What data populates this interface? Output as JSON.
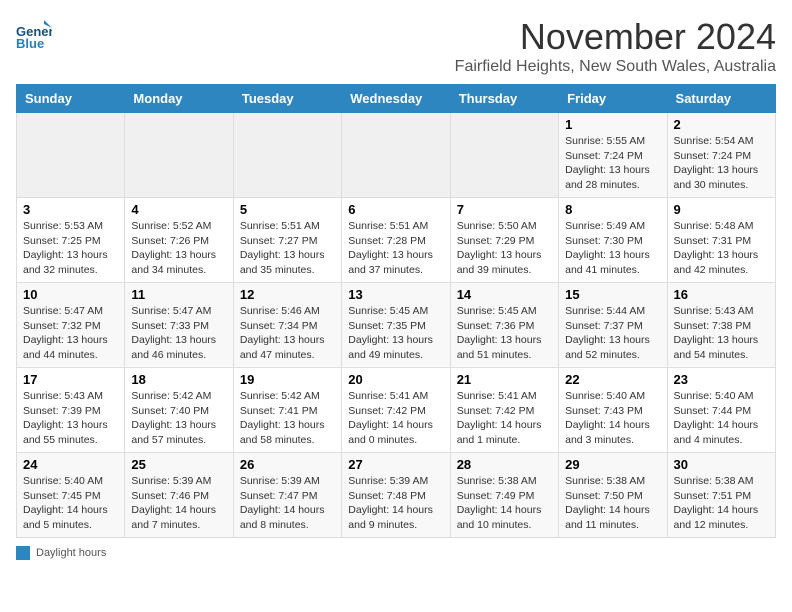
{
  "header": {
    "logo_general": "General",
    "logo_blue": "Blue",
    "month_title": "November 2024",
    "subtitle": "Fairfield Heights, New South Wales, Australia"
  },
  "days_of_week": [
    "Sunday",
    "Monday",
    "Tuesday",
    "Wednesday",
    "Thursday",
    "Friday",
    "Saturday"
  ],
  "weeks": [
    [
      {
        "day": "",
        "info": ""
      },
      {
        "day": "",
        "info": ""
      },
      {
        "day": "",
        "info": ""
      },
      {
        "day": "",
        "info": ""
      },
      {
        "day": "",
        "info": ""
      },
      {
        "day": "1",
        "info": "Sunrise: 5:55 AM\nSunset: 7:24 PM\nDaylight: 13 hours and 28 minutes."
      },
      {
        "day": "2",
        "info": "Sunrise: 5:54 AM\nSunset: 7:24 PM\nDaylight: 13 hours and 30 minutes."
      }
    ],
    [
      {
        "day": "3",
        "info": "Sunrise: 5:53 AM\nSunset: 7:25 PM\nDaylight: 13 hours and 32 minutes."
      },
      {
        "day": "4",
        "info": "Sunrise: 5:52 AM\nSunset: 7:26 PM\nDaylight: 13 hours and 34 minutes."
      },
      {
        "day": "5",
        "info": "Sunrise: 5:51 AM\nSunset: 7:27 PM\nDaylight: 13 hours and 35 minutes."
      },
      {
        "day": "6",
        "info": "Sunrise: 5:51 AM\nSunset: 7:28 PM\nDaylight: 13 hours and 37 minutes."
      },
      {
        "day": "7",
        "info": "Sunrise: 5:50 AM\nSunset: 7:29 PM\nDaylight: 13 hours and 39 minutes."
      },
      {
        "day": "8",
        "info": "Sunrise: 5:49 AM\nSunset: 7:30 PM\nDaylight: 13 hours and 41 minutes."
      },
      {
        "day": "9",
        "info": "Sunrise: 5:48 AM\nSunset: 7:31 PM\nDaylight: 13 hours and 42 minutes."
      }
    ],
    [
      {
        "day": "10",
        "info": "Sunrise: 5:47 AM\nSunset: 7:32 PM\nDaylight: 13 hours and 44 minutes."
      },
      {
        "day": "11",
        "info": "Sunrise: 5:47 AM\nSunset: 7:33 PM\nDaylight: 13 hours and 46 minutes."
      },
      {
        "day": "12",
        "info": "Sunrise: 5:46 AM\nSunset: 7:34 PM\nDaylight: 13 hours and 47 minutes."
      },
      {
        "day": "13",
        "info": "Sunrise: 5:45 AM\nSunset: 7:35 PM\nDaylight: 13 hours and 49 minutes."
      },
      {
        "day": "14",
        "info": "Sunrise: 5:45 AM\nSunset: 7:36 PM\nDaylight: 13 hours and 51 minutes."
      },
      {
        "day": "15",
        "info": "Sunrise: 5:44 AM\nSunset: 7:37 PM\nDaylight: 13 hours and 52 minutes."
      },
      {
        "day": "16",
        "info": "Sunrise: 5:43 AM\nSunset: 7:38 PM\nDaylight: 13 hours and 54 minutes."
      }
    ],
    [
      {
        "day": "17",
        "info": "Sunrise: 5:43 AM\nSunset: 7:39 PM\nDaylight: 13 hours and 55 minutes."
      },
      {
        "day": "18",
        "info": "Sunrise: 5:42 AM\nSunset: 7:40 PM\nDaylight: 13 hours and 57 minutes."
      },
      {
        "day": "19",
        "info": "Sunrise: 5:42 AM\nSunset: 7:41 PM\nDaylight: 13 hours and 58 minutes."
      },
      {
        "day": "20",
        "info": "Sunrise: 5:41 AM\nSunset: 7:42 PM\nDaylight: 14 hours and 0 minutes."
      },
      {
        "day": "21",
        "info": "Sunrise: 5:41 AM\nSunset: 7:42 PM\nDaylight: 14 hours and 1 minute."
      },
      {
        "day": "22",
        "info": "Sunrise: 5:40 AM\nSunset: 7:43 PM\nDaylight: 14 hours and 3 minutes."
      },
      {
        "day": "23",
        "info": "Sunrise: 5:40 AM\nSunset: 7:44 PM\nDaylight: 14 hours and 4 minutes."
      }
    ],
    [
      {
        "day": "24",
        "info": "Sunrise: 5:40 AM\nSunset: 7:45 PM\nDaylight: 14 hours and 5 minutes."
      },
      {
        "day": "25",
        "info": "Sunrise: 5:39 AM\nSunset: 7:46 PM\nDaylight: 14 hours and 7 minutes."
      },
      {
        "day": "26",
        "info": "Sunrise: 5:39 AM\nSunset: 7:47 PM\nDaylight: 14 hours and 8 minutes."
      },
      {
        "day": "27",
        "info": "Sunrise: 5:39 AM\nSunset: 7:48 PM\nDaylight: 14 hours and 9 minutes."
      },
      {
        "day": "28",
        "info": "Sunrise: 5:38 AM\nSunset: 7:49 PM\nDaylight: 14 hours and 10 minutes."
      },
      {
        "day": "29",
        "info": "Sunrise: 5:38 AM\nSunset: 7:50 PM\nDaylight: 14 hours and 11 minutes."
      },
      {
        "day": "30",
        "info": "Sunrise: 5:38 AM\nSunset: 7:51 PM\nDaylight: 14 hours and 12 minutes."
      }
    ]
  ],
  "footer": {
    "legend_label": "Daylight hours"
  }
}
